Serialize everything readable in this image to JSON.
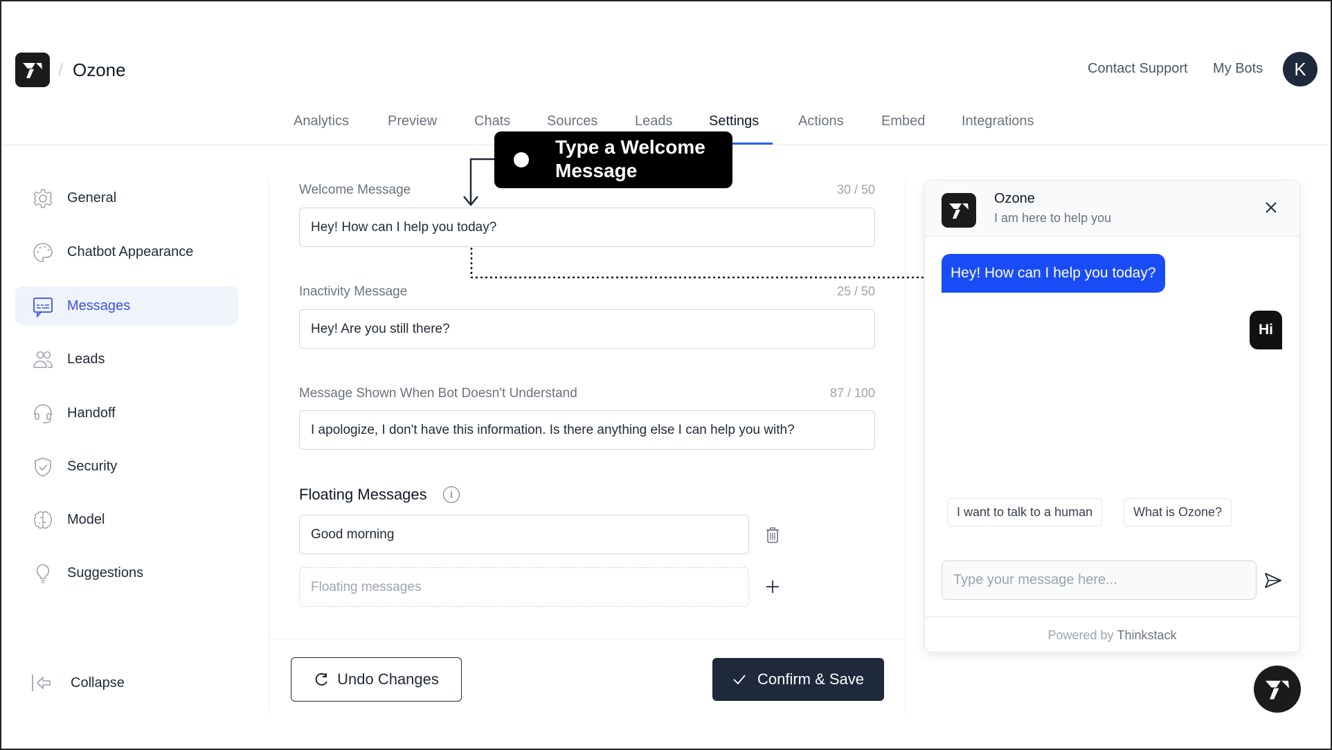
{
  "header": {
    "app_title": "Ozone",
    "breadcrumb_separator": "/",
    "links": [
      "Contact Support",
      "My Bots"
    ],
    "avatar_initial": "K"
  },
  "tabs": [
    {
      "label": "Analytics",
      "active": false
    },
    {
      "label": "Preview",
      "active": false
    },
    {
      "label": "Chats",
      "active": false
    },
    {
      "label": "Sources",
      "active": false
    },
    {
      "label": "Leads",
      "active": false
    },
    {
      "label": "Settings",
      "active": true
    },
    {
      "label": "Actions",
      "active": false
    },
    {
      "label": "Embed",
      "active": false
    },
    {
      "label": "Integrations",
      "active": false
    }
  ],
  "sidebar": {
    "items": [
      {
        "label": "General",
        "icon": "gear-icon",
        "active": false
      },
      {
        "label": "Chatbot Appearance",
        "icon": "palette-icon",
        "active": false
      },
      {
        "label": "Messages",
        "icon": "message-icon",
        "active": true
      },
      {
        "label": "Leads",
        "icon": "users-icon",
        "active": false
      },
      {
        "label": "Handoff",
        "icon": "headset-icon",
        "active": false
      },
      {
        "label": "Security",
        "icon": "shield-check-icon",
        "active": false
      },
      {
        "label": "Model",
        "icon": "brain-icon",
        "active": false
      },
      {
        "label": "Suggestions",
        "icon": "lightbulb-icon",
        "active": false
      }
    ],
    "collapse_label": "Collapse"
  },
  "form": {
    "welcome": {
      "label": "Welcome Message",
      "count": "30 / 50",
      "value": "Hey! How can I help you today?"
    },
    "inactivity": {
      "label": "Inactivity Message",
      "count": "25 / 50",
      "value": "Hey! Are you still there?"
    },
    "fallback": {
      "label": "Message Shown When Bot Doesn't Understand",
      "count": "87 / 100",
      "value": "I apologize, I don't have this information. Is there anything else I can help you with?"
    },
    "floating": {
      "title": "Floating Messages",
      "items": [
        "Good morning"
      ],
      "new_placeholder": "Floating messages"
    },
    "undo_label": "Undo Changes",
    "confirm_label": "Confirm & Save"
  },
  "callout": {
    "text_line1": "Type a Welcome",
    "text_line2": "Message"
  },
  "chat_preview": {
    "bot_name": "Ozone",
    "bot_subtitle": "I am here to help you",
    "bot_message": "Hey! How can I help you today?",
    "user_message": "Hi",
    "suggestions": [
      "I want to talk to a human",
      "What is Ozone?"
    ],
    "input_placeholder": "Type your message here...",
    "footer_prefix": "Powered by",
    "footer_brand": "Thinkstack"
  },
  "colors": {
    "accent": "#2563eb",
    "bot_bubble": "#1a4cf6",
    "primary_button": "#1e293b",
    "active_sidebar_bg": "#eff3fa",
    "active_sidebar_text": "#3b4fe4"
  }
}
